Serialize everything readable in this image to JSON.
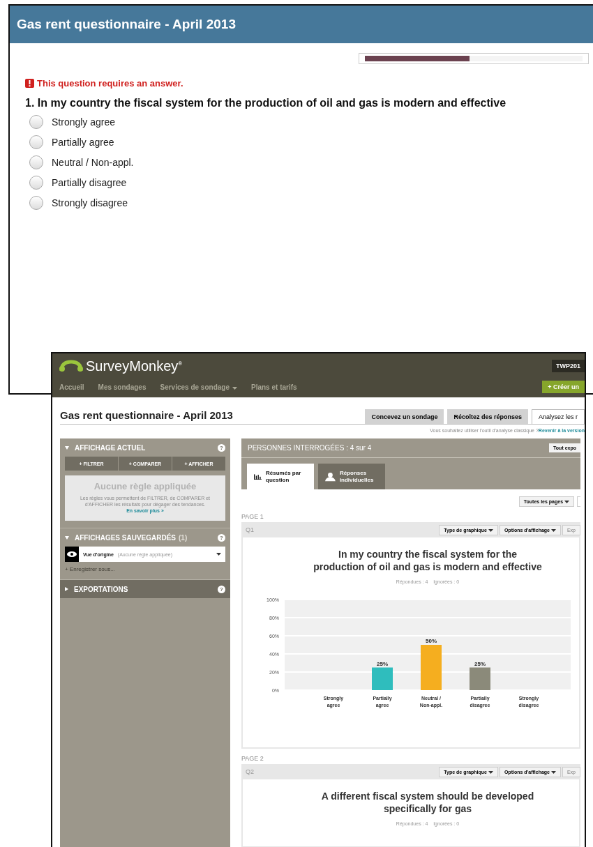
{
  "survey_form": {
    "title": "Gas rent questionnaire - April 2013",
    "progress": {
      "level": 0.48
    },
    "error": "This question requires an answer.",
    "question": "1. In my country the fiscal system for the production of oil and gas is modern and effective",
    "options": [
      {
        "label": "Strongly agree",
        "selected": false
      },
      {
        "label": "Partially agree",
        "selected": false
      },
      {
        "label": "Neutral / Non-appl.",
        "selected": false
      },
      {
        "label": "Partially disagree",
        "selected": false
      },
      {
        "label": "Strongly disagree",
        "selected": false
      }
    ]
  },
  "analysis": {
    "logo": "SurveyMonkey",
    "logo_mark": "®",
    "account": "TWP201",
    "nav": [
      {
        "label": "Accueil",
        "dropdown": false
      },
      {
        "label": "Mes sondages",
        "dropdown": false
      },
      {
        "label": "Services de sondage",
        "dropdown": true
      },
      {
        "label": "Plans et tarifs",
        "dropdown": false
      }
    ],
    "create_button": "+ Créer un",
    "title": "Gas rent questionnaire - April 2013",
    "top_tabs": [
      {
        "label": "Concevez un sondage",
        "selected": false
      },
      {
        "label": "Récoltez des réponses",
        "selected": false
      },
      {
        "label": "Analysez les r",
        "selected": true
      }
    ],
    "classic_prompt": "Vous souhaitez utiliser l'outil d'analyse classique ?",
    "classic_link": "Revenir à la version",
    "sidebar": {
      "current_view": {
        "title": "AFFICHAGE ACTUEL",
        "help": "?",
        "buttons": [
          "+ FILTRER",
          "+ COMPARER",
          "+ AFFICHER"
        ],
        "empty_title": "Aucune règle appliquée",
        "empty_text": "Les règles vous permettent de FILTRER, de COMPARER et d'AFFICHER les résultats pour dégager des tendances.",
        "learn_more": "En savoir plus »"
      },
      "saved_views": {
        "title": "AFFICHAGES SAUVEGARDÉS",
        "help": "?",
        "count": "(1)",
        "view_name": "Vue d'origine",
        "view_note": "(Aucune règle appliquée)",
        "save_as": "+ Enregistrer sous..."
      },
      "exports": {
        "title": "EXPORTATIONS",
        "help": "?"
      }
    },
    "respondents": "PERSONNES INTERROGÉES : 4 sur 4",
    "export_all": "Tout expo",
    "view_tabs": [
      {
        "label": "Résumés par question",
        "kind": "summary",
        "selected": true
      },
      {
        "label": "Réponses individuelles",
        "kind": "individual",
        "selected": false
      }
    ],
    "page_filter": "Toutes les pages",
    "pages": [
      {
        "label": "PAGE 1",
        "question_id": "Q1",
        "chart_type": "Type de graphique",
        "display_options": "Options d'affichage",
        "export": "Exp",
        "question": "In my country the fiscal system for the production of oil and gas is modern and effective",
        "stats": "Répondues : 4    Ignorées : 0",
        "chart_data": {
          "type": "bar",
          "categories": [
            "Strongly agree",
            "Partially agree",
            "Neutral / Non-appl.",
            "Partially disagree",
            "Strongly disagree"
          ],
          "series": [
            {
              "values": [
                0,
                25,
                50,
                25,
                0
              ]
            }
          ],
          "colors": [
            null,
            "#2fbdbd",
            "#f5ae1f",
            "#8b8a7a",
            null
          ],
          "grid": true,
          "ylim": [
            0,
            100
          ],
          "yticks": [
            {
              "value": 0,
              "label": "0%"
            },
            {
              "value": 20,
              "label": "20%"
            },
            {
              "value": 40,
              "label": "40%"
            },
            {
              "value": 60,
              "label": "60%"
            },
            {
              "value": 80,
              "label": "80%"
            },
            {
              "value": 100,
              "label": "100%"
            }
          ],
          "value_labels": [
            null,
            "25%",
            "50%",
            "25%",
            null
          ]
        }
      },
      {
        "label": "PAGE 2",
        "question_id": "Q2",
        "chart_type": "Type de graphique",
        "display_options": "Options d'affichage",
        "export": "Exp",
        "question": "A different fiscal system should be developed specifically for gas",
        "stats": "Répondues : 4    Ignorées : 0"
      }
    ]
  }
}
